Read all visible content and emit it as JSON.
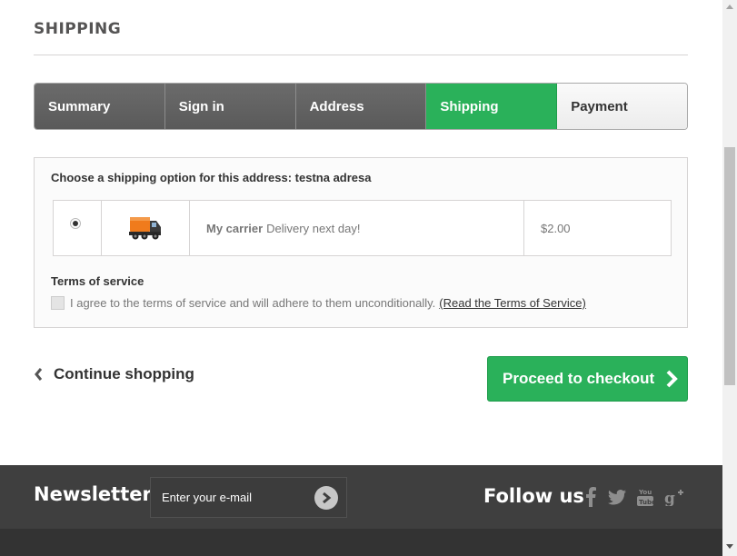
{
  "page": {
    "heading": "SHIPPING"
  },
  "steps": [
    {
      "label": "Summary",
      "state": "done"
    },
    {
      "label": "Sign in",
      "state": "done"
    },
    {
      "label": "Address",
      "state": "done"
    },
    {
      "label": "Shipping",
      "state": "current"
    },
    {
      "label": "Payment",
      "state": "todo"
    }
  ],
  "shipping": {
    "title": "Choose a shipping option for this address: testna adresa",
    "carrier": {
      "selected": true,
      "icon": "truck-icon",
      "name": "My carrier",
      "delay": "Delivery next day!",
      "price": "$2.00"
    }
  },
  "terms": {
    "title": "Terms of service",
    "checkbox_label": "I agree to the terms of service and will adhere to them unconditionally.",
    "link_label": "(Read the Terms of Service)",
    "checked": false
  },
  "actions": {
    "continue_label": "Continue shopping",
    "checkout_label": "Proceed to checkout"
  },
  "footer": {
    "newsletter_title": "Newsletter",
    "newsletter_placeholder": "Enter your e-mail",
    "follow_title": "Follow us",
    "social": [
      "facebook-icon",
      "twitter-icon",
      "youtube-icon",
      "google-plus-icon"
    ]
  },
  "colors": {
    "accent_green": "#2ab15a",
    "step_done": "#5f5f5f",
    "footer_bg": "#3f3f3f"
  }
}
